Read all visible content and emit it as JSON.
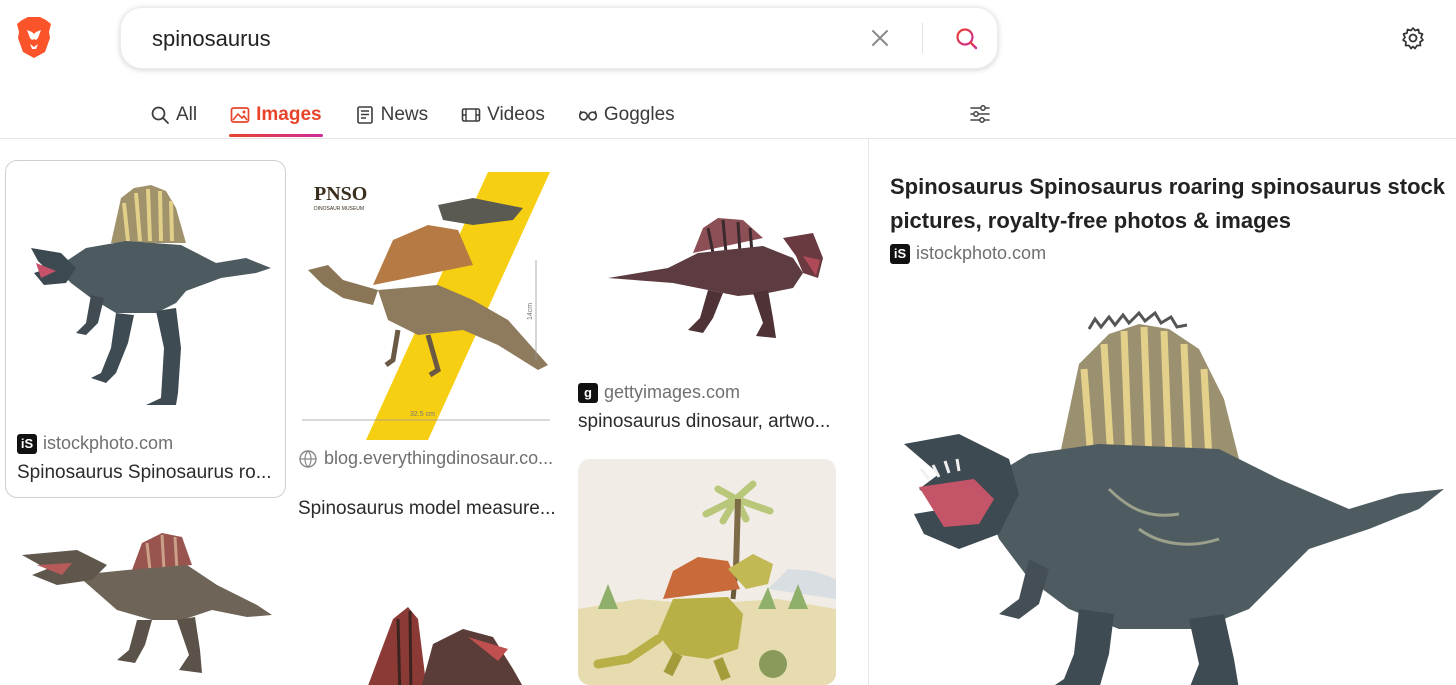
{
  "search": {
    "query": "spinosaurus"
  },
  "tabs": [
    {
      "label": "All",
      "icon": "search-icon",
      "active": false
    },
    {
      "label": "Images",
      "icon": "image-icon",
      "active": true
    },
    {
      "label": "News",
      "icon": "news-icon",
      "active": false
    },
    {
      "label": "Videos",
      "icon": "video-icon",
      "active": false
    },
    {
      "label": "Goggles",
      "icon": "goggles-icon",
      "active": false
    }
  ],
  "results": [
    {
      "source": "istockphoto.com",
      "favicon_text": "iS",
      "title": "Spinosaurus Spinosaurus ro..."
    },
    {
      "source": "blog.everythingdinosaur.co...",
      "favicon_text": "",
      "title": "Spinosaurus model measure...",
      "image_text": {
        "brand": "PNSO",
        "brand_sub": "DINOSAUR MUSEUM",
        "height": "14cm",
        "length": "32.5 cm"
      }
    },
    {
      "source": "gettyimages.com",
      "favicon_text": "g",
      "title": "spinosaurus dinosaur, artwo..."
    }
  ],
  "detail": {
    "title": "Spinosaurus Spinosaurus roaring spinosaurus stock pictures, royalty-free photos & images",
    "source": "istockphoto.com",
    "favicon_text": "iS"
  },
  "colors": {
    "accent": "#e8442b",
    "accent_end": "#cf2a9b",
    "brand_orange": "#fb542b"
  }
}
